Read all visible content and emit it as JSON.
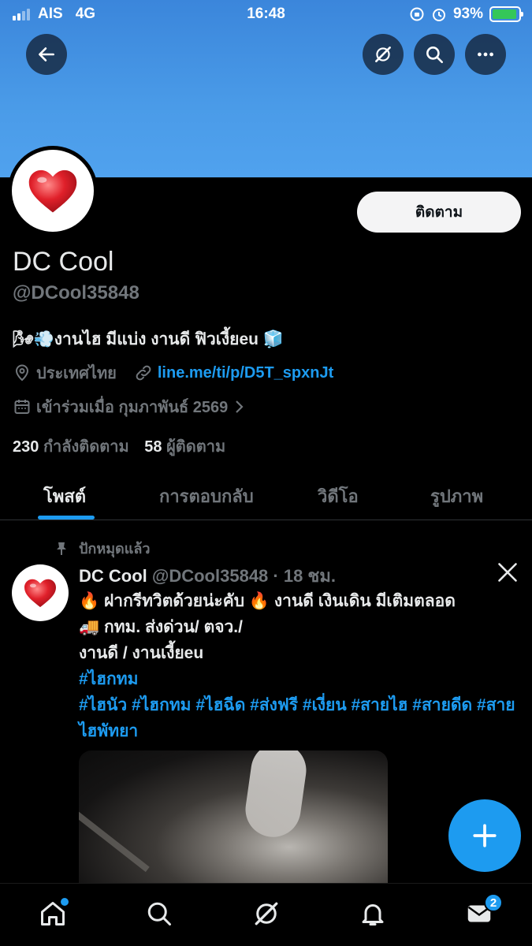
{
  "status_bar": {
    "carrier": "AIS",
    "network": "4G",
    "time": "16:48",
    "battery": "93%",
    "battery_level": 0.93
  },
  "header": {
    "back_icon": "back-arrow-icon",
    "buttons": [
      "grok-icon",
      "search-icon",
      "more-icon"
    ]
  },
  "profile": {
    "follow_label": "ติดตาม",
    "name": "DC Cool",
    "handle": "@DCool35848",
    "bio": "🌬💨งานไฮ มีแบ่ง งานดี ฟิวเงี้ยeu 🧊",
    "location": "ประเทศไทย",
    "link": "line.me/ti/p/D5T_spxnJt",
    "joined": "เข้าร่วมเมื่อ กุมภาพันธ์ 2569",
    "following_count": "230",
    "following_label": "กำลังติดตาม",
    "followers_count": "58",
    "followers_label": "ผู้ติดตาม"
  },
  "tabs": [
    {
      "label": "โพสต์",
      "active": true
    },
    {
      "label": "การตอบกลับ",
      "active": false
    },
    {
      "label": "วิดีโอ",
      "active": false
    },
    {
      "label": "รูปภาพ",
      "active": false
    }
  ],
  "post": {
    "pinned_label": "ปักหมุดแล้ว",
    "author": "DC Cool",
    "handle_time": "@DCool35848 · 18 ชม.",
    "line1": "🔥 ฝากรีทวิตด้วยน่ะคับ 🔥  งานดี เงินเดิน มีเติมตลอด",
    "line2": "🚚 กทม. ส่งด่วน/ ตจว./",
    "line3": "งานดี /  งานเงี้ยeu",
    "hashtag_line1": "#ไฮกทม",
    "hashtag_line2": "#ไฮนัว #ไฮกทม #ไฮฉีด #ส่งฟรี #เงี่ยน #สายไฮ #สายดีด #สายไฮพัทยา"
  },
  "bottom_nav": {
    "items": [
      "home-icon",
      "search-icon",
      "grok-icon",
      "notifications-icon",
      "messages-icon"
    ],
    "messages_badge": "2"
  },
  "colors": {
    "accent": "#1d9bf0",
    "banner": "#4a9be8",
    "background": "#000000"
  }
}
